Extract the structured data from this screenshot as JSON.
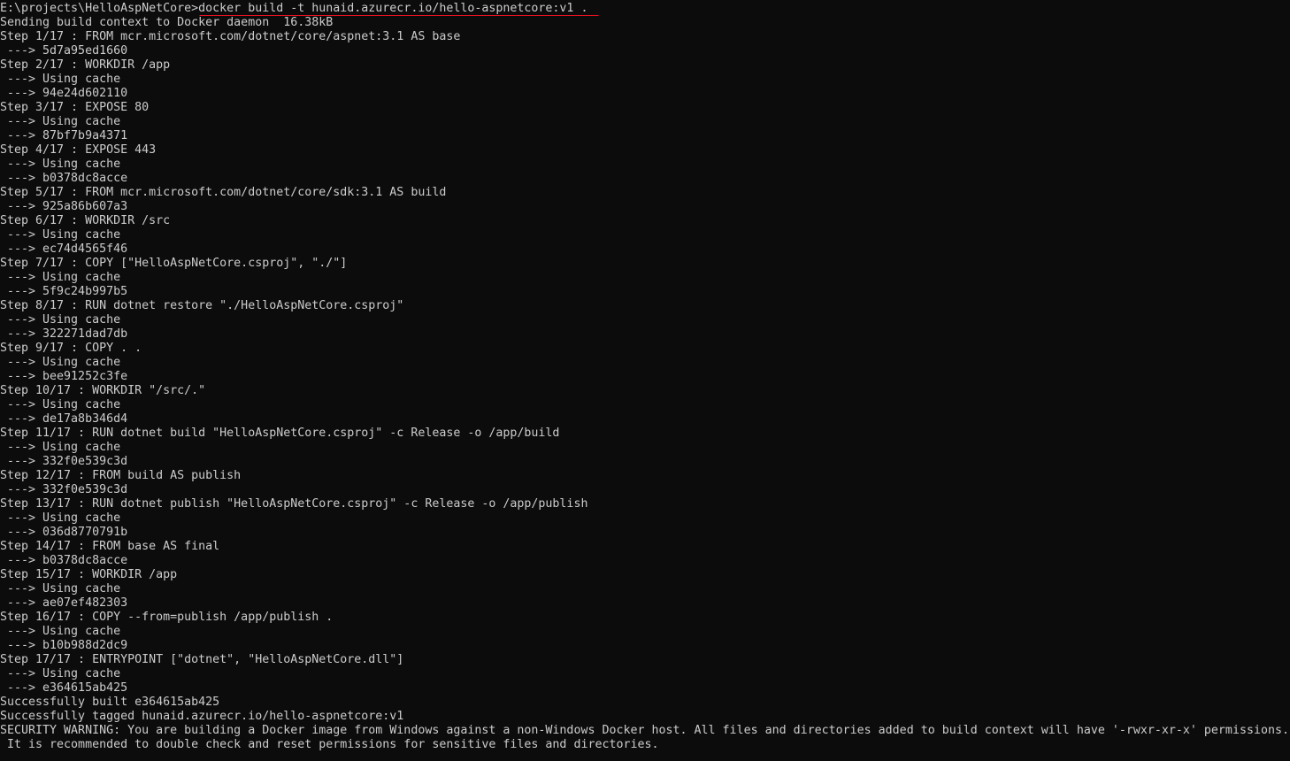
{
  "terminal": {
    "prompt": "E:\\projects\\HelloAspNetCore>",
    "command": "docker build -t hunaid.azurecr.io/hello-aspnetcore:v1 .",
    "highlight_color": "#e81123",
    "lines": [
      "Sending build context to Docker daemon  16.38kB",
      "Step 1/17 : FROM mcr.microsoft.com/dotnet/core/aspnet:3.1 AS base",
      " ---> 5d7a95ed1660",
      "Step 2/17 : WORKDIR /app",
      " ---> Using cache",
      " ---> 94e24d602110",
      "Step 3/17 : EXPOSE 80",
      " ---> Using cache",
      " ---> 87bf7b9a4371",
      "Step 4/17 : EXPOSE 443",
      " ---> Using cache",
      " ---> b0378dc8acce",
      "Step 5/17 : FROM mcr.microsoft.com/dotnet/core/sdk:3.1 AS build",
      " ---> 925a86b607a3",
      "Step 6/17 : WORKDIR /src",
      " ---> Using cache",
      " ---> ec74d4565f46",
      "Step 7/17 : COPY [\"HelloAspNetCore.csproj\", \"./\"]",
      " ---> Using cache",
      " ---> 5f9c24b997b5",
      "Step 8/17 : RUN dotnet restore \"./HelloAspNetCore.csproj\"",
      " ---> Using cache",
      " ---> 322271dad7db",
      "Step 9/17 : COPY . .",
      " ---> Using cache",
      " ---> bee91252c3fe",
      "Step 10/17 : WORKDIR \"/src/.\"",
      " ---> Using cache",
      " ---> de17a8b346d4",
      "Step 11/17 : RUN dotnet build \"HelloAspNetCore.csproj\" -c Release -o /app/build",
      " ---> Using cache",
      " ---> 332f0e539c3d",
      "Step 12/17 : FROM build AS publish",
      " ---> 332f0e539c3d",
      "Step 13/17 : RUN dotnet publish \"HelloAspNetCore.csproj\" -c Release -o /app/publish",
      " ---> Using cache",
      " ---> 036d8770791b",
      "Step 14/17 : FROM base AS final",
      " ---> b0378dc8acce",
      "Step 15/17 : WORKDIR /app",
      " ---> Using cache",
      " ---> ae07ef482303",
      "Step 16/17 : COPY --from=publish /app/publish .",
      " ---> Using cache",
      " ---> b10b988d2dc9",
      "Step 17/17 : ENTRYPOINT [\"dotnet\", \"HelloAspNetCore.dll\"]",
      " ---> Using cache",
      " ---> e364615ab425",
      "Successfully built e364615ab425",
      "Successfully tagged hunaid.azurecr.io/hello-aspnetcore:v1",
      "SECURITY WARNING: You are building a Docker image from Windows against a non-Windows Docker host. All files and directories added to build context will have '-rwxr-xr-x' permissions.",
      " It is recommended to double check and reset permissions for sensitive files and directories."
    ]
  }
}
